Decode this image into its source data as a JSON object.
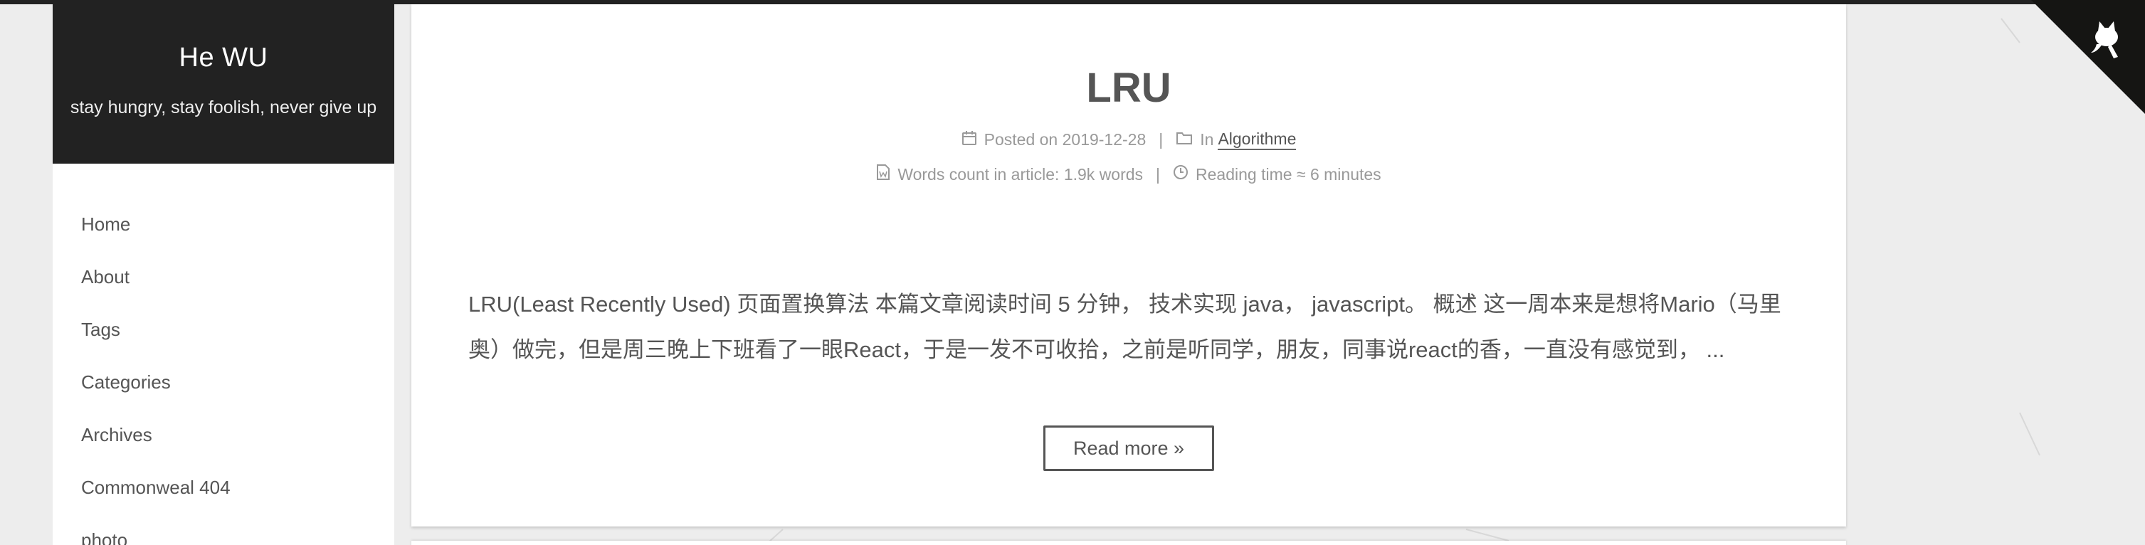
{
  "site": {
    "title": "He WU",
    "subtitle": "stay hungry, stay foolish, never give up"
  },
  "menu": [
    {
      "label": "Home"
    },
    {
      "label": "About"
    },
    {
      "label": "Tags"
    },
    {
      "label": "Categories"
    },
    {
      "label": "Archives"
    },
    {
      "label": "Commonweal 404"
    },
    {
      "label": "photo"
    }
  ],
  "post": {
    "title": "LRU",
    "posted_label": "Posted on",
    "posted_date": "2019-12-28",
    "in_label": "In",
    "category": "Algorithme",
    "words_label": "Words count in article:",
    "words_value": "1.9k words",
    "reading_label": "Reading time ≈",
    "reading_value": "6 minutes",
    "excerpt": "LRU(Least Recently Used) 页面置换算法 本篇文章阅读时间 5 分钟， 技术实现 java， javascript。 概述 这一周本来是想将Mario（马里奥）做完，但是周三晚上下班看了一眼React，于是一发不可收拾，之前是听同学，朋友，同事说react的香，一直没有感觉到， ...",
    "read_more": "Read more »",
    "separator": "|"
  },
  "icons": {
    "calendar": "calendar-icon",
    "folder": "folder-icon",
    "file": "file-word-icon",
    "clock": "clock-icon",
    "github": "github-corner-icon"
  },
  "colors": {
    "header_bg": "#222222",
    "text": "#555555",
    "meta": "#999999",
    "page_bg": "#ededed"
  }
}
